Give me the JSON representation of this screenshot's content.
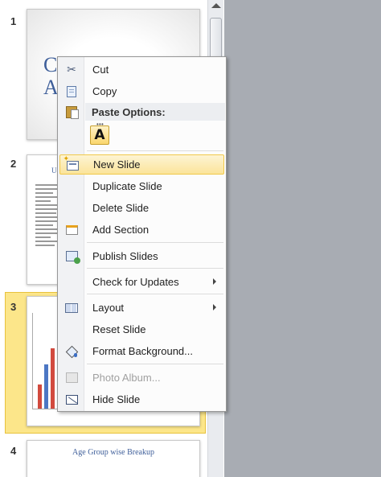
{
  "slides": [
    {
      "number": "1",
      "title_text": "C\nA"
    },
    {
      "number": "2",
      "title_text": "U"
    },
    {
      "number": "3"
    },
    {
      "number": "4",
      "title_text": "Age Group wise Breakup"
    }
  ],
  "context_menu": {
    "items": [
      {
        "id": "cut",
        "label": "Cut",
        "icon": "scissors-icon"
      },
      {
        "id": "copy",
        "label": "Copy",
        "icon": "copy-icon"
      },
      {
        "id": "paste_options",
        "label": "Paste Options:",
        "icon": "paste-icon"
      },
      {
        "id": "paste_keep_text",
        "label": "A"
      },
      {
        "id": "new_slide",
        "label": "New Slide",
        "icon": "new-slide-icon",
        "highlighted": true
      },
      {
        "id": "duplicate_slide",
        "label": "Duplicate Slide"
      },
      {
        "id": "delete_slide",
        "label": "Delete Slide"
      },
      {
        "id": "add_section",
        "label": "Add Section",
        "icon": "add-section-icon"
      },
      {
        "id": "publish_slides",
        "label": "Publish Slides",
        "icon": "publish-slides-icon"
      },
      {
        "id": "check_updates",
        "label": "Check for Updates",
        "submenu": true
      },
      {
        "id": "layout",
        "label": "Layout",
        "icon": "layout-icon",
        "submenu": true
      },
      {
        "id": "reset_slide",
        "label": "Reset Slide"
      },
      {
        "id": "format_background",
        "label": "Format Background...",
        "icon": "format-background-icon"
      },
      {
        "id": "photo_album",
        "label": "Photo Album...",
        "icon": "photo-album-icon",
        "disabled": true
      },
      {
        "id": "hide_slide",
        "label": "Hide Slide",
        "icon": "hide-slide-icon"
      }
    ]
  },
  "colors": {
    "highlight": "#fbe49a",
    "selected_slide": "#fce68a",
    "editor_bg": "#a8acb3"
  }
}
